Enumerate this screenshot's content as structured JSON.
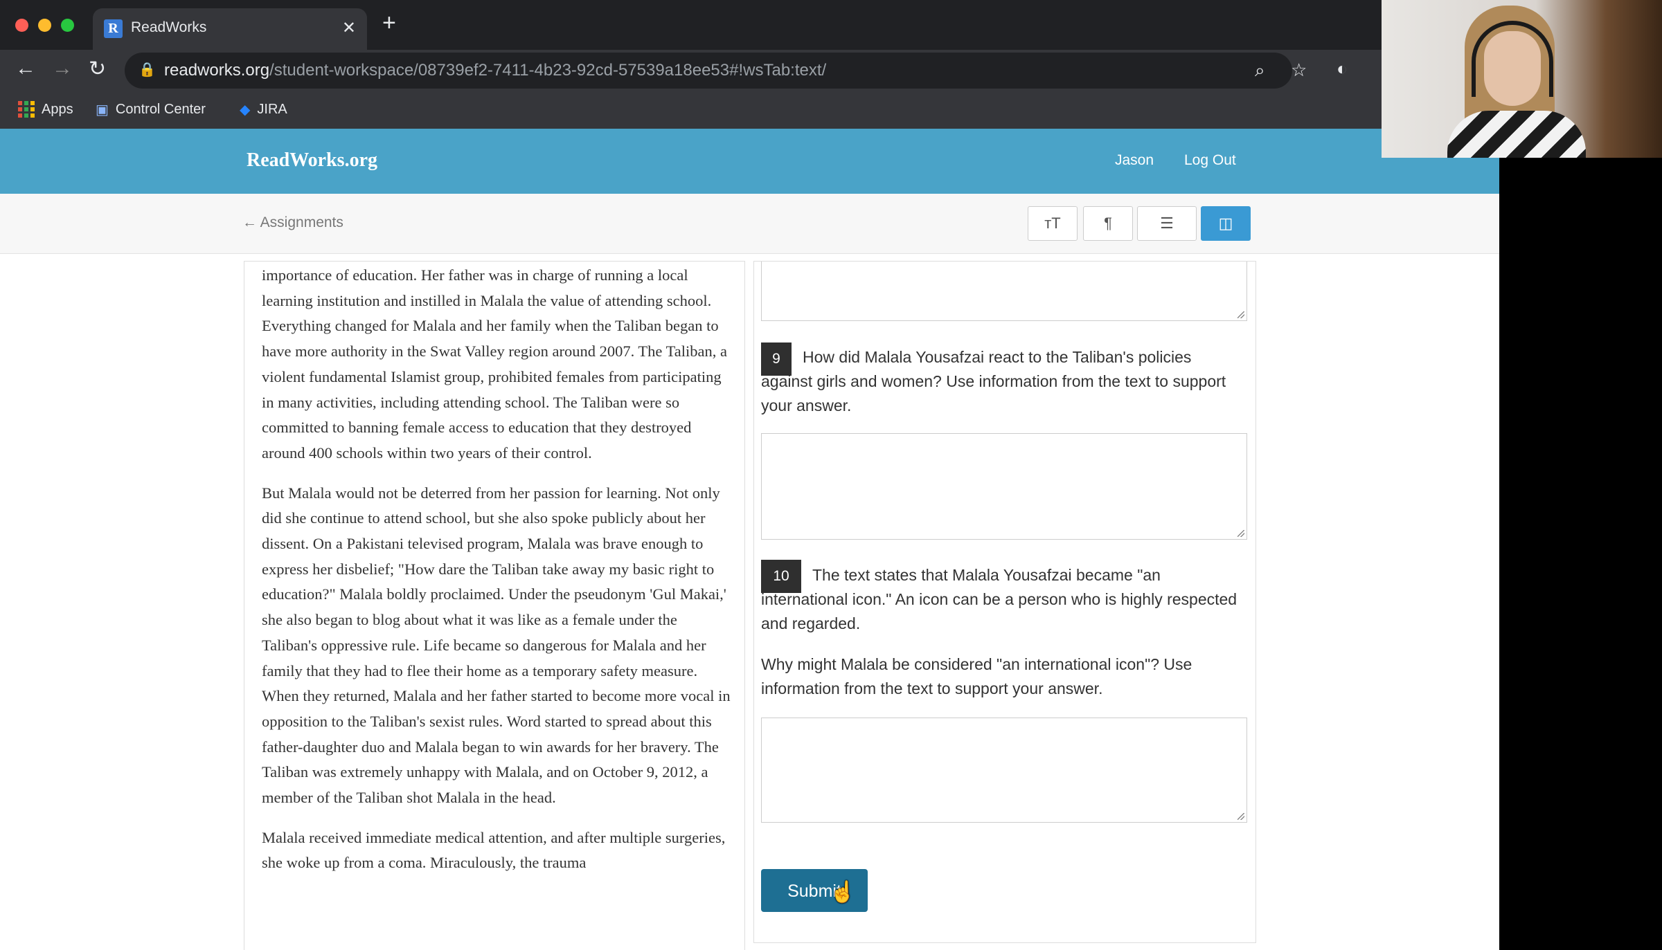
{
  "browser": {
    "tab_title": "ReadWorks",
    "tab_favicon": "R",
    "url_domain": "readworks.org",
    "url_path": "/student-workspace/08739ef2-7411-4b23-92cd-57539a18ee53#!wsTab:text/",
    "bookmarks": [
      "Apps",
      "Control Center",
      "JIRA"
    ]
  },
  "site": {
    "logo": "ReadWorks.org",
    "user": "Jason",
    "logout": "Log Out",
    "back_link": "← Assignments"
  },
  "passage": {
    "paragraphs": [
      "importance of education. Her father was in charge of running a local learning institution and instilled in Malala the value of attending school. Everything changed for Malala and her family when the Taliban began to have more authority in the Swat Valley region around 2007. The Taliban, a violent fundamental Islamist group, prohibited females from participating in many activities, including attending school. The Taliban were so committed to banning female access to education that they destroyed around 400 schools within two years of their control.",
      "But Malala would not be deterred from her passion for learning. Not only did she continue to attend school, but she also spoke publicly about her dissent. On a Pakistani televised program, Malala was brave enough to express her disbelief; \"How dare the Taliban take away my basic right to education?\" Malala boldly proclaimed. Under the pseudonym 'Gul Makai,' she also began to blog about what it was like as a female under the Taliban's oppressive rule. Life became so dangerous for Malala and her family that they had to flee their home as a temporary safety measure. When they returned, Malala and her father started to become more vocal in opposition to the Taliban's sexist rules. Word started to spread about this father-daughter duo and Malala began to win awards for her bravery. The Taliban was extremely unhappy with Malala, and on October 9, 2012, a member of the Taliban shot Malala in the head.",
      "Malala received immediate medical attention, and after multiple surgeries, she woke up from a coma. Miraculously, the trauma"
    ]
  },
  "questions": [
    {
      "number": "9",
      "text": "How did Malala Yousafzai react to the Taliban's policies against girls and women? Use information from the text to support your answer."
    },
    {
      "number": "10",
      "text": "The text states that Malala Yousafzai became \"an international icon.\" An icon can be a person who is highly respected and regarded.",
      "followup": "Why might Malala be considered \"an international icon\"? Use information from the text to support your answer."
    }
  ],
  "submit_label": "Submit"
}
